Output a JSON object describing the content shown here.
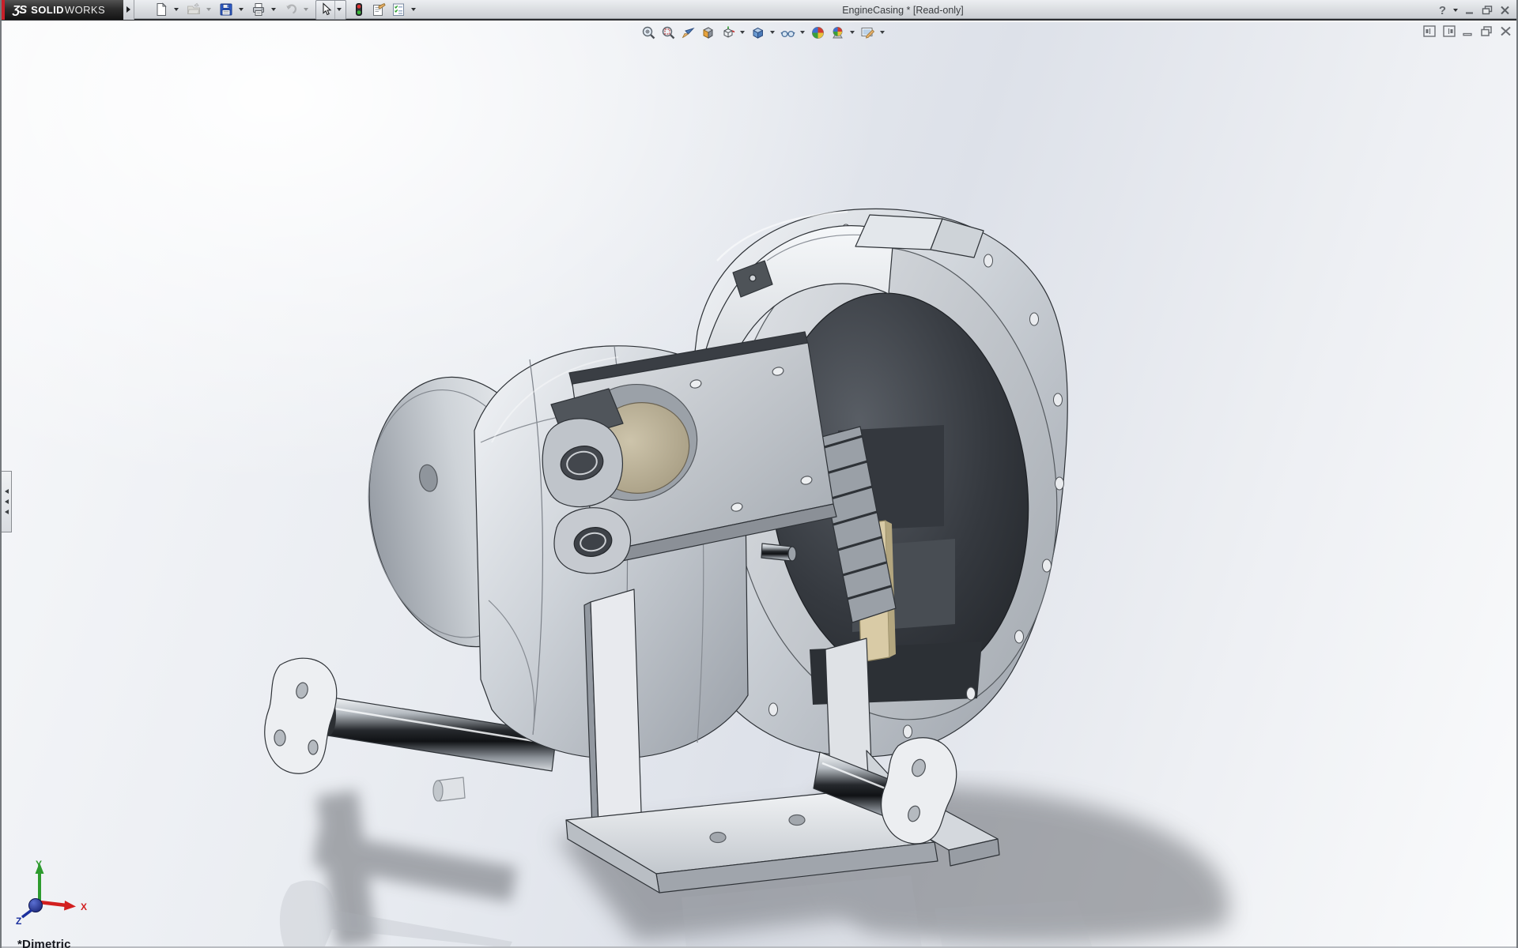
{
  "titlebar": {
    "brand": {
      "glyph": "ƷS",
      "bold": "SOLID",
      "light": "WORKS"
    },
    "title": "EngineCasing * [Read-only]",
    "window_controls": {
      "help_label": "?",
      "items": [
        {
          "name": "help",
          "has_dropdown": true
        },
        {
          "name": "minimize"
        },
        {
          "name": "restore"
        },
        {
          "name": "close"
        }
      ]
    }
  },
  "main_toolbar": {
    "items": [
      {
        "name": "new-document",
        "has_dropdown": true,
        "enabled": true
      },
      {
        "name": "open",
        "has_dropdown": true,
        "enabled": false
      },
      {
        "name": "save",
        "has_dropdown": true,
        "enabled": true
      },
      {
        "name": "print",
        "has_dropdown": true,
        "enabled": true
      },
      {
        "name": "undo",
        "has_dropdown": true,
        "enabled": false
      },
      {
        "name": "select",
        "has_dropdown": true,
        "enabled": true,
        "active": true
      },
      {
        "name": "traffic-light",
        "has_dropdown": false,
        "enabled": true
      },
      {
        "name": "file-properties",
        "has_dropdown": false,
        "enabled": true
      },
      {
        "name": "options-checklist",
        "has_dropdown": true,
        "enabled": true
      }
    ]
  },
  "headsup_toolbar": {
    "items": [
      {
        "name": "zoom-to-fit"
      },
      {
        "name": "zoom-to-area"
      },
      {
        "name": "previous-view"
      },
      {
        "name": "section-view"
      },
      {
        "name": "view-orientation",
        "has_dropdown": true
      },
      {
        "name": "display-style",
        "has_dropdown": true
      },
      {
        "name": "hide-show-items",
        "has_dropdown": true
      },
      {
        "name": "edit-appearance"
      },
      {
        "name": "apply-scene",
        "has_dropdown": true
      },
      {
        "name": "view-settings",
        "has_dropdown": true
      }
    ]
  },
  "document_controls": {
    "items": [
      {
        "name": "show-left-pane"
      },
      {
        "name": "show-right-pane"
      },
      {
        "name": "minimize-document"
      },
      {
        "name": "restore-document"
      },
      {
        "name": "close-document"
      }
    ]
  },
  "left_edge": {
    "collapsed_panel_tab": "feature-manager-flyout"
  },
  "viewport": {
    "subject": "engine casing 3D assembly, shaded-with-edges, on stand with chrome axles",
    "orientation_label": "*Dimetric",
    "triad": {
      "x_label": "X",
      "y_label": "Y",
      "z_label": "Z"
    }
  },
  "colors": {
    "brand_red": "#c8202a",
    "logo_dark": "#1e1e1e",
    "titlebar_top": "#eceef1",
    "titlebar_bottom": "#c9cdd2",
    "titlebar_divider": "#2a2c2f",
    "viewport_gray": "#dde1e9",
    "viewport_white": "#fafbfc",
    "save_blue": "#2f5fce",
    "traffic_red": "#e03232",
    "traffic_green": "#3ab83a",
    "metal_light": "#eef1f4",
    "metal_mid": "#b5bac1",
    "metal_dark": "#34383d",
    "cavity_dark": "#23262b",
    "tan_part": "#d9cba6",
    "chrome_dark": "#17191d",
    "shadow_gray": "#5d6166",
    "triad_x_red": "#d21f1f",
    "triad_y_green": "#2e9b2e",
    "triad_z_blue": "#1a2f9e"
  }
}
